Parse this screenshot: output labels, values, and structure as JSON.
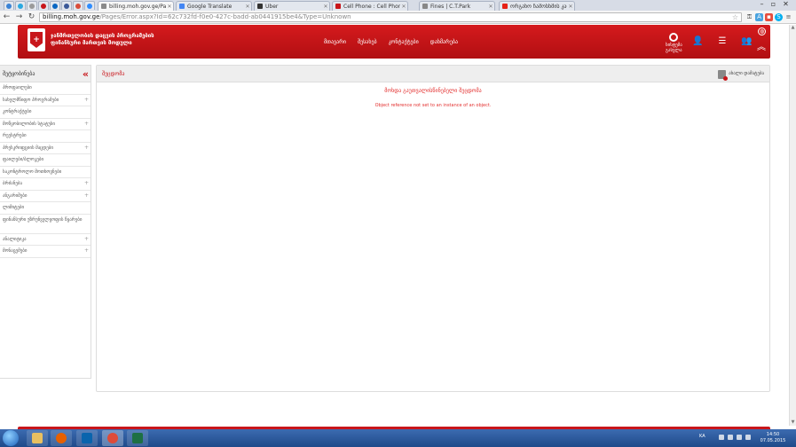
{
  "browser": {
    "tabs": [
      {
        "title": "billing.moh.gov.ge/Pages/",
        "active": true,
        "color": "#8a8a8a"
      },
      {
        "title": "Google Translate",
        "active": false,
        "color": "#4285f4"
      },
      {
        "title": "Uber",
        "active": false,
        "color": "#333333"
      },
      {
        "title": "Cell Phone : Cell Phones",
        "active": false,
        "color": "#c8161b"
      },
      {
        "title": "Fines | C.T.Park",
        "active": false,
        "color": "#888888"
      },
      {
        "title": "ორგანო ჩამოსხმის კარეო",
        "active": false,
        "color": "#e62117"
      }
    ],
    "url_host": "billing.moh.gov.ge",
    "url_path": "/Pages/Error.aspx?Id=62c732fd-f0e0-427c-badd-ab0441915be4&Type=Unknown"
  },
  "header": {
    "title_line1": "ჯანმრთელობის დაცვის პროგრამების",
    "title_line2": "ფინანსური მართვის მოდული",
    "nav": [
      "მთავარი",
      "შესახებ",
      "კონტაქტები",
      "დახმარება"
    ],
    "user_label": "სისტემა\nგასვლა"
  },
  "sidebar": {
    "title": "შეტყობინება",
    "items": [
      {
        "label": "პროფაილები",
        "plus": false,
        "tall": false
      },
      {
        "label": "სახელმწიფო პროგრამები",
        "plus": true,
        "tall": false
      },
      {
        "label": "კონტრაქტები",
        "plus": false,
        "tall": false
      },
      {
        "label": "მოწყობილობის სტატუსი",
        "plus": true,
        "tall": false
      },
      {
        "label": "რეესტრები",
        "plus": false,
        "tall": false
      },
      {
        "label": "პრესკრიფციის მაცდები",
        "plus": true,
        "tall": false
      },
      {
        "label": "ფაილები/ბლოკები",
        "plus": false,
        "tall": false
      },
      {
        "label": "საკონტროლო მოთხოვნები",
        "plus": false,
        "tall": false
      },
      {
        "label": "ბრძანება",
        "plus": true,
        "tall": false
      },
      {
        "label": "ანგარიშები",
        "plus": true,
        "tall": false
      },
      {
        "label": "ლიმიტები",
        "plus": false,
        "tall": false
      },
      {
        "label": "ფინანსური უზრუნველყოფის წყარები",
        "plus": false,
        "tall": true
      },
      {
        "label": "ანალიტიკა",
        "plus": true,
        "tall": false
      },
      {
        "label": "მონაცემები",
        "plus": true,
        "tall": false
      }
    ]
  },
  "panel": {
    "title": "შეცდომა",
    "action_label": "ახალი დამატება",
    "error_title": "მოხდა გაუთვალისწინებელი შეცდომა",
    "error_message": "Object reference not set to an instance of an object."
  },
  "taskbar": {
    "apps": [
      {
        "name": "explorer",
        "color": "#e8c060"
      },
      {
        "name": "firefox",
        "color": "#e66000"
      },
      {
        "name": "outlook",
        "color": "#0a64ad"
      },
      {
        "name": "chrome",
        "color": "#dd4b39"
      },
      {
        "name": "excel",
        "color": "#1d7044"
      }
    ],
    "lang": "KA",
    "time": "14:50",
    "date": "07.05.2015"
  },
  "colors": {
    "brand_red": "#c8161b",
    "error_red": "#e3302f"
  }
}
